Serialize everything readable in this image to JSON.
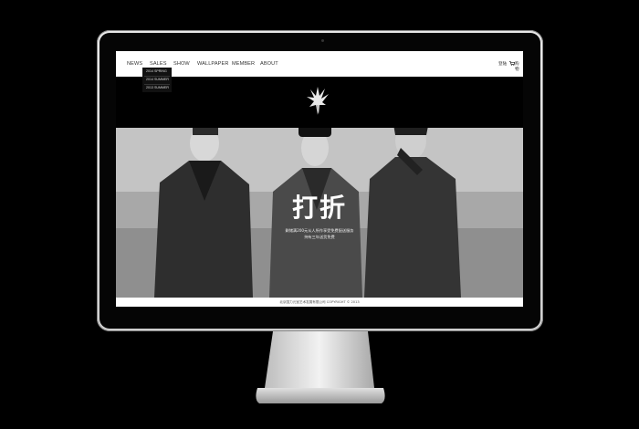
{
  "nav": {
    "items": [
      "NEWS",
      "SALES",
      "SHOW",
      "WALLPAPER",
      "MEMBER",
      "ABOUT"
    ],
    "right_login": "登陆",
    "right_cart": "购物"
  },
  "dropdown": {
    "items": [
      "2014 SPRING",
      "2014 SUMMER",
      "2013 SUMMER"
    ]
  },
  "hero": {
    "title": "打折",
    "line1": "剩储满200元从人所作享受免费配送服务",
    "line2": "持有三年送货免费"
  },
  "footer": {
    "text": "北京国力元宝艺术发展有限公司   COPYRIGHT © 2013"
  },
  "colors": {
    "page_bg": "#000000",
    "banner_bg": "#000000",
    "nav_bg": "#ffffff",
    "hero_text": "#ffffff"
  }
}
